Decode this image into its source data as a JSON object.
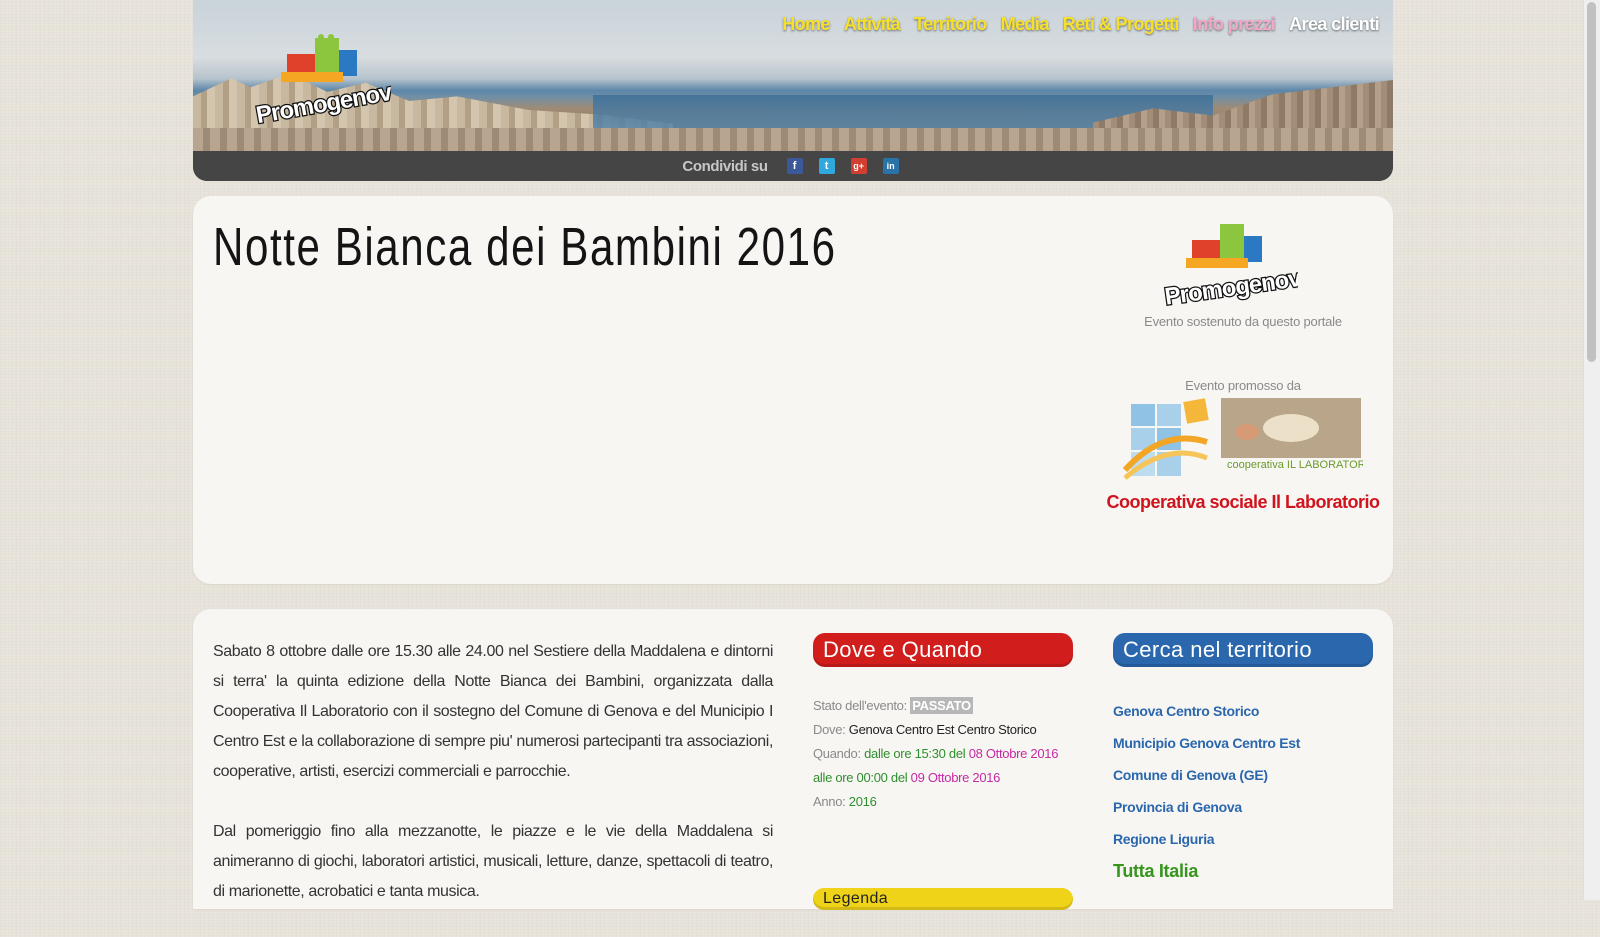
{
  "header": {
    "nav": [
      {
        "label": "Home",
        "color": "#f7e02a"
      },
      {
        "label": "Attività",
        "color": "#f7e02a"
      },
      {
        "label": "Territorio",
        "color": "#f7e02a"
      },
      {
        "label": "Media",
        "color": "#f7e02a"
      },
      {
        "label": "Reti & Progetti",
        "color": "#f7e02a"
      },
      {
        "label": "Info prezzi",
        "color": "#f0a7c8"
      },
      {
        "label": "Area clienti",
        "color": "#ffffff"
      }
    ],
    "logo_text": "Promogenova.it",
    "share": {
      "label": "Condividi su",
      "icons": [
        {
          "name": "facebook-icon",
          "glyph": "f",
          "color": "#3b5998"
        },
        {
          "name": "twitter-icon",
          "glyph": "t",
          "color": "#2fa8de"
        },
        {
          "name": "google-plus-icon",
          "glyph": "g+",
          "color": "#d23f31"
        },
        {
          "name": "linkedin-icon",
          "glyph": "in",
          "color": "#2a73a8"
        }
      ]
    }
  },
  "event": {
    "title": "Notte Bianca dei Bambini 2016",
    "sustained_caption": "Evento sostenuto da questo portale",
    "promoted_caption": "Evento promosso da",
    "promoter_logo_text": "cooperativa IL LABORATORIO",
    "promoter_name": "Cooperativa sociale Il Laboratorio",
    "description": [
      "Sabato 8 ottobre dalle ore 15.30 alle 24.00 nel Sestiere della Maddalena e dintorni si terra' la quinta edizione della Notte Bianca dei Bambini, organizzata dalla Cooperativa Il Laboratorio con il sostegno del Comune di Genova e del Municipio I Centro Est e la collaborazione di sempre piu' numerosi partecipanti tra associazioni, cooperative, artisti, esercizi commerciali e parrocchie.",
      "Dal pomeriggio fino alla mezzanotte, le piazze e le vie della Maddalena si animeranno di giochi, laboratori artistici, musicali, letture, danze, spettacoli di teatro, di marionette, acrobatici e tanta musica."
    ]
  },
  "dove_quando": {
    "title": "Dove e Quando",
    "status_label": "Stato dell'evento:",
    "status_value": "PASSATO",
    "where_label": "Dove:",
    "where_value": "Genova Centro Est Centro Storico",
    "when_label": "Quando:",
    "when_part1": "dalle ore 15:30 del",
    "when_date1": "08 Ottobre 2016",
    "when_part2": "alle ore 00:00 del",
    "when_date2": "09 Ottobre 2016",
    "year_label": "Anno:",
    "year_value": "2016"
  },
  "cerca": {
    "title": "Cerca nel territorio",
    "links": [
      "Genova Centro Storico",
      "Municipio Genova Centro Est",
      "Comune di Genova (GE)",
      "Provincia di Genova",
      "Regione Liguria",
      "Tutta Italia"
    ]
  },
  "legenda": {
    "title": "Legenda"
  }
}
